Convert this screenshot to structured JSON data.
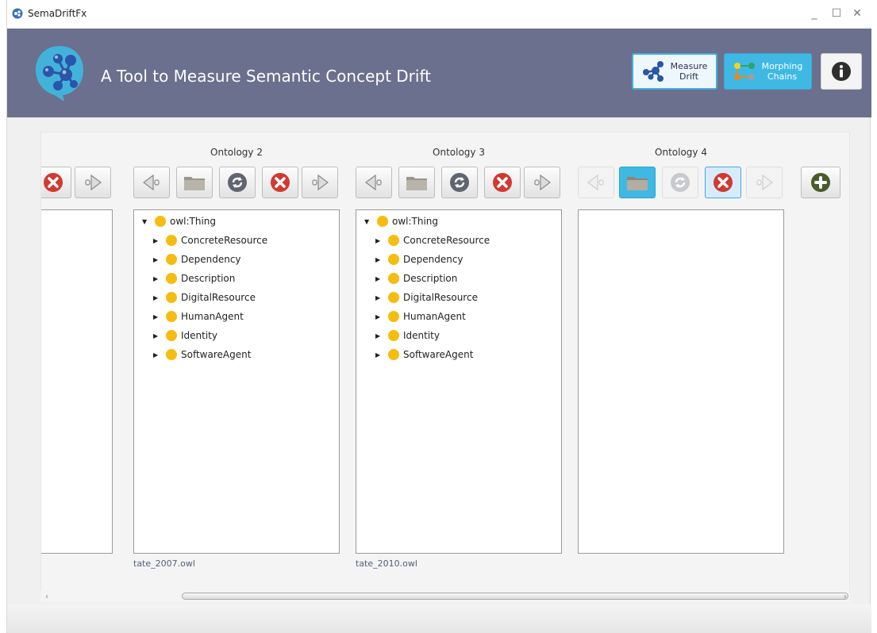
{
  "window": {
    "title": "SemaDriftFx",
    "minimize": "_",
    "maximize": "☐",
    "close": "✕"
  },
  "header": {
    "heading": "A Tool to Measure Semantic Concept Drift",
    "measure_drift_line1": "Measure",
    "measure_drift_line2": "Drift",
    "morphing_chains_line1": "Morphing",
    "morphing_chains_line2": "Chains",
    "info_icon": "info-icon"
  },
  "ontologies": [
    {
      "title": "",
      "file": ""
    },
    {
      "title": "Ontology 2",
      "file": "tate_2007.owl",
      "tree": {
        "root": "owl:Thing",
        "children": [
          "ConcreteResource",
          "Dependency",
          "Description",
          "DigitalResource",
          "HumanAgent",
          "Identity",
          "SoftwareAgent"
        ]
      }
    },
    {
      "title": "Ontology 3",
      "file": "tate_2010.owl",
      "tree": {
        "root": "owl:Thing",
        "children": [
          "ConcreteResource",
          "Dependency",
          "Description",
          "DigitalResource",
          "HumanAgent",
          "Identity",
          "SoftwareAgent"
        ]
      }
    },
    {
      "title": "Ontology 4",
      "file": ""
    }
  ],
  "colors": {
    "header_bg": "#6a708d",
    "accent": "#3fb9e3",
    "concept_dot": "#f6bc0f"
  }
}
